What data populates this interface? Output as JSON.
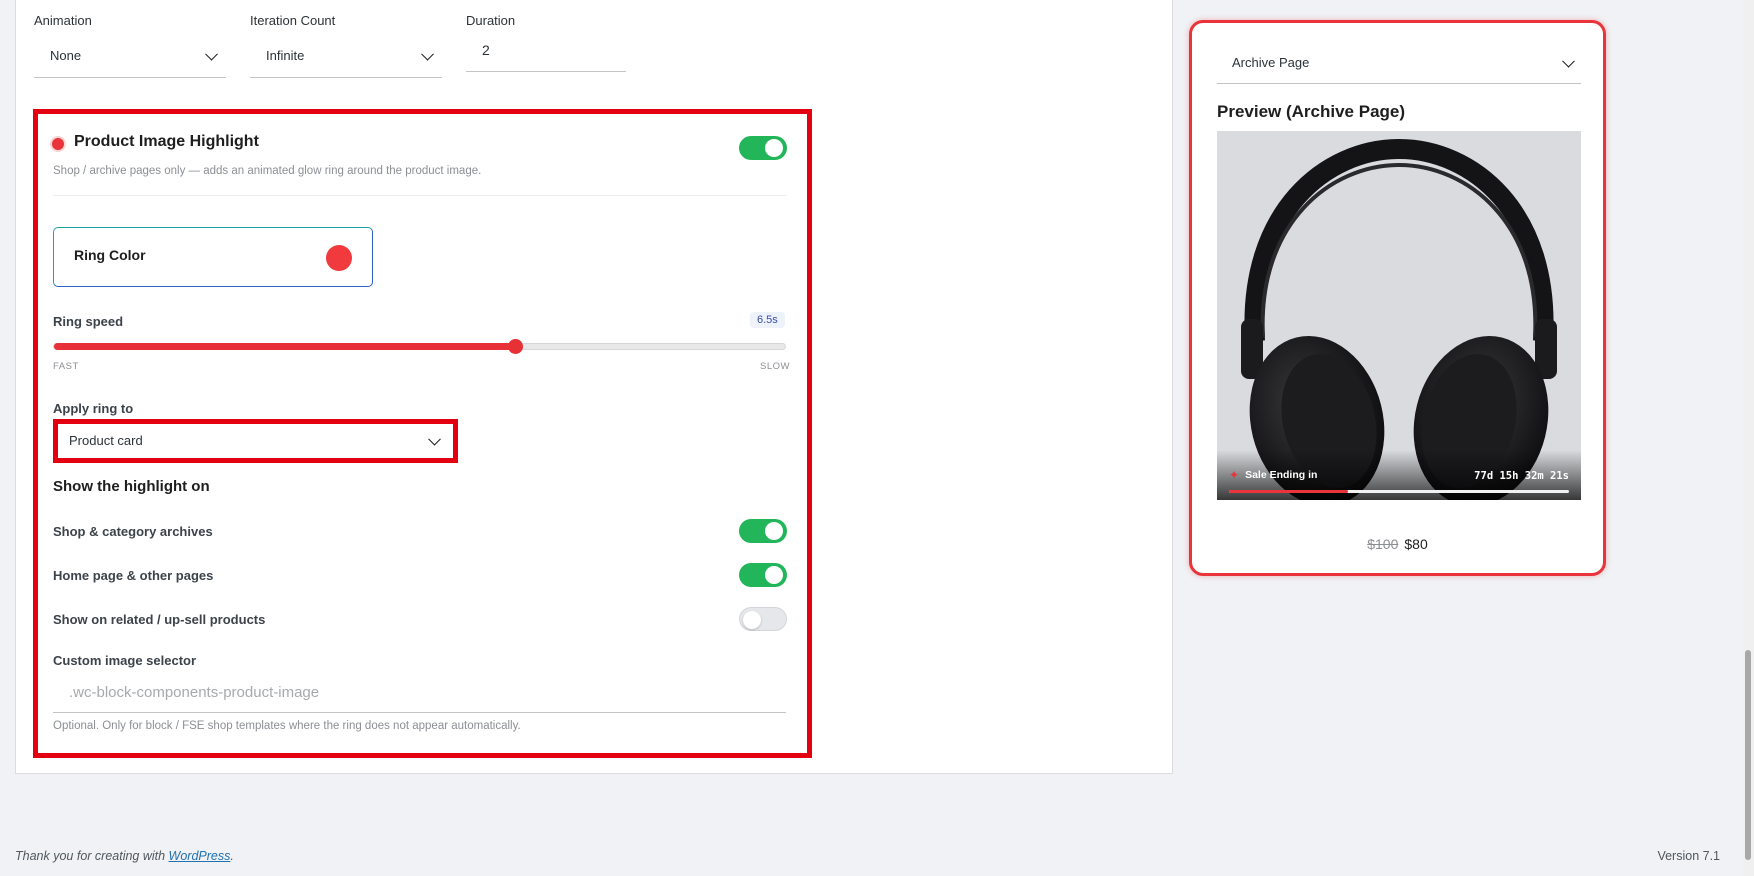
{
  "top_fields": {
    "animation": {
      "label": "Animation",
      "value": "None"
    },
    "iteration": {
      "label": "Iteration Count",
      "value": "Infinite"
    },
    "duration": {
      "label": "Duration",
      "value": "2"
    }
  },
  "highlight": {
    "title": "Product Image Highlight",
    "description": "Shop / archive pages only — adds an animated glow ring around the product image.",
    "enabled": true,
    "ring_color_label": "Ring Color",
    "ring_color": "#f03a3e",
    "ring_speed_label": "Ring speed",
    "ring_speed_value": "6.5s",
    "ring_speed_fraction": 0.63,
    "fast_label": "FAST",
    "slow_label": "SLOW",
    "apply_label": "Apply ring to",
    "apply_value": "Product card",
    "show_heading": "Show the highlight on",
    "options": [
      {
        "label": "Shop & category archives",
        "on": true
      },
      {
        "label": "Home page & other pages",
        "on": true
      },
      {
        "label": "Show on related / up-sell products",
        "on": false
      }
    ],
    "custom_label": "Custom image selector",
    "custom_placeholder": ".wc-block-components-product-image",
    "custom_help": "Optional. Only for block / FSE shop templates where the ring does not appear automatically."
  },
  "preview": {
    "page_select": "Archive Page",
    "title": "Preview (Archive Page)",
    "sale_text": "Sale Ending in",
    "timer": "77d 15h 32m 21s",
    "progress_fraction": 0.35,
    "old_price": "$100",
    "new_price": "$80"
  },
  "footer": {
    "thanks_prefix": "Thank you for creating with ",
    "thanks_link": "WordPress",
    "thanks_suffix": ".",
    "version": "Version 7.1"
  },
  "colors": {
    "accent": "#e8343a",
    "toggle_on": "#22b55a",
    "highlight_border": "#e30010"
  }
}
